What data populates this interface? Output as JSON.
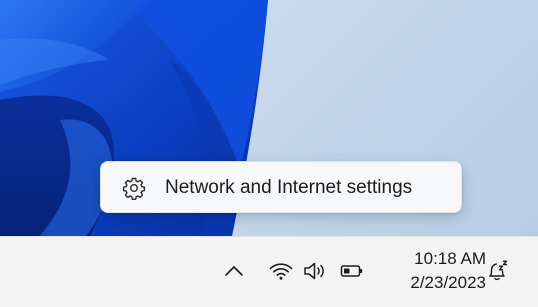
{
  "context_menu": {
    "item_label": "Network and Internet settings",
    "item_icon": "gear-icon"
  },
  "taskbar": {
    "overflow_icon": "chevron-up-icon",
    "wifi_icon": "wifi-icon",
    "volume_icon": "volume-icon",
    "battery_icon": "battery-icon",
    "time": "10:18 AM",
    "date": "2/23/2023",
    "notification_icon": "notification-bell-snooze-icon"
  },
  "colors": {
    "wallpaper_light": "#c6d8ea",
    "wallpaper_bloom": "#0b3fc2",
    "taskbar_bg": "#f3f3f3",
    "menu_bg": "#f7f8fa",
    "text": "#1c1c1c"
  }
}
